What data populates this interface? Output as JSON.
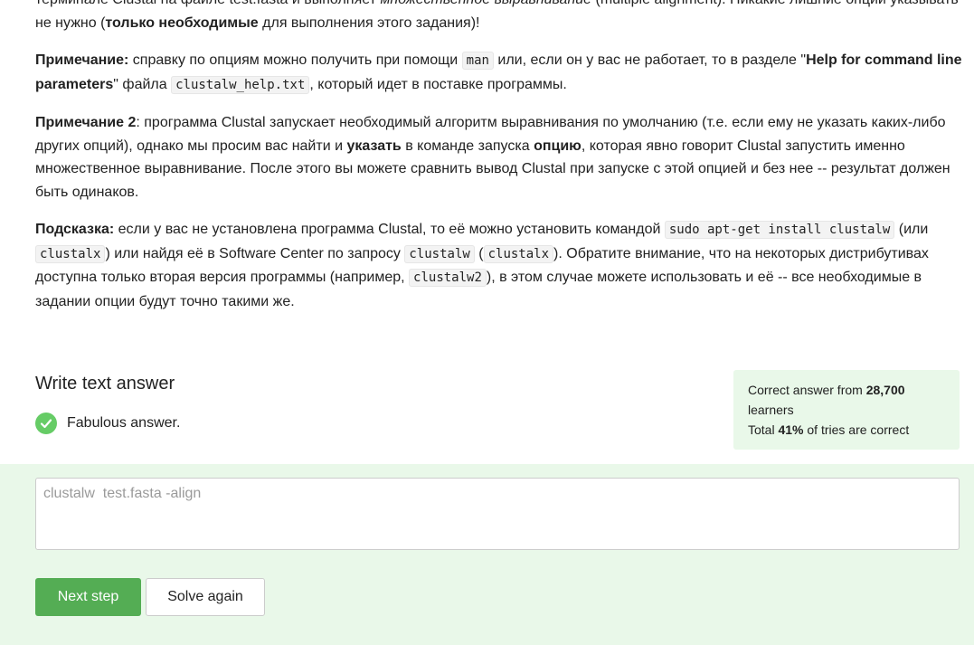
{
  "step_text": {
    "p0_a": "терминале Clustal на файле test.fasta и выполняет ",
    "p0_b": "множественное выравнивание",
    "p0_c": " (multiple alignment). Никакие лишние опции указывать не нужно (",
    "p0_d": "только необходимые",
    "p0_e": " для выполнения этого задания)!",
    "p1_label": "Примечание:",
    "p1_a": " справку по опциям можно получить при помощи ",
    "p1_code1": "man",
    "p1_b": " или, если он у вас не работает, то в разделе \"",
    "p1_bold": "Help for command line parameters",
    "p1_c": "\" файла ",
    "p1_code2": "clustalw_help.txt",
    "p1_d": ", который идет в поставке программы.",
    "p2_label": "Примечание 2",
    "p2_a": ": программа Clustal запускает необходимый алгоритм выравнивания по умолчанию (т.е. если ему не указать каких-либо других опций), однако мы просим вас найти и ",
    "p2_bold1": "указать",
    "p2_b": " в команде запуска ",
    "p2_bold2": "опцию",
    "p2_c": ", которая явно говорит Clustal запустить именно множественное выравнивание. После этого вы можете сравнить вывод Clustal при запуске с этой опцией и без нее -- результат должен быть одинаков.",
    "p3_label": "Подсказка:",
    "p3_a": " если у вас не установлена программа Clustal, то её можно установить командой ",
    "p3_code1": "sudo apt-get install clustalw",
    "p3_b": " (или ",
    "p3_code2": "clustalx",
    "p3_c": ") или найдя её в Software Center по запросу ",
    "p3_code3": "clustalw",
    "p3_d": " (",
    "p3_code4": "clustalx",
    "p3_e": "). Обратите внимание, что на некоторых дистрибутивах доступна только вторая версия программы (например, ",
    "p3_code5": "clustalw2",
    "p3_f": "), в этом случае можете использовать и её -- все необходимые в задании опции будут точно такими же."
  },
  "answer": {
    "header": "Write text answer",
    "status": "Fabulous answer.",
    "value": "clustalw  test.fasta -align"
  },
  "stats": {
    "line1_prefix": "Correct answer from ",
    "learners_count": "28,700",
    "line1_suffix": " learners",
    "line2_prefix": "Total ",
    "percent": "41%",
    "line2_suffix": " of tries are correct"
  },
  "buttons": {
    "next": "Next step",
    "again": "Solve again"
  },
  "colors": {
    "success_green": "#66cc66",
    "button_green": "#54ad54",
    "panel_bg": "#e9f8e9"
  }
}
